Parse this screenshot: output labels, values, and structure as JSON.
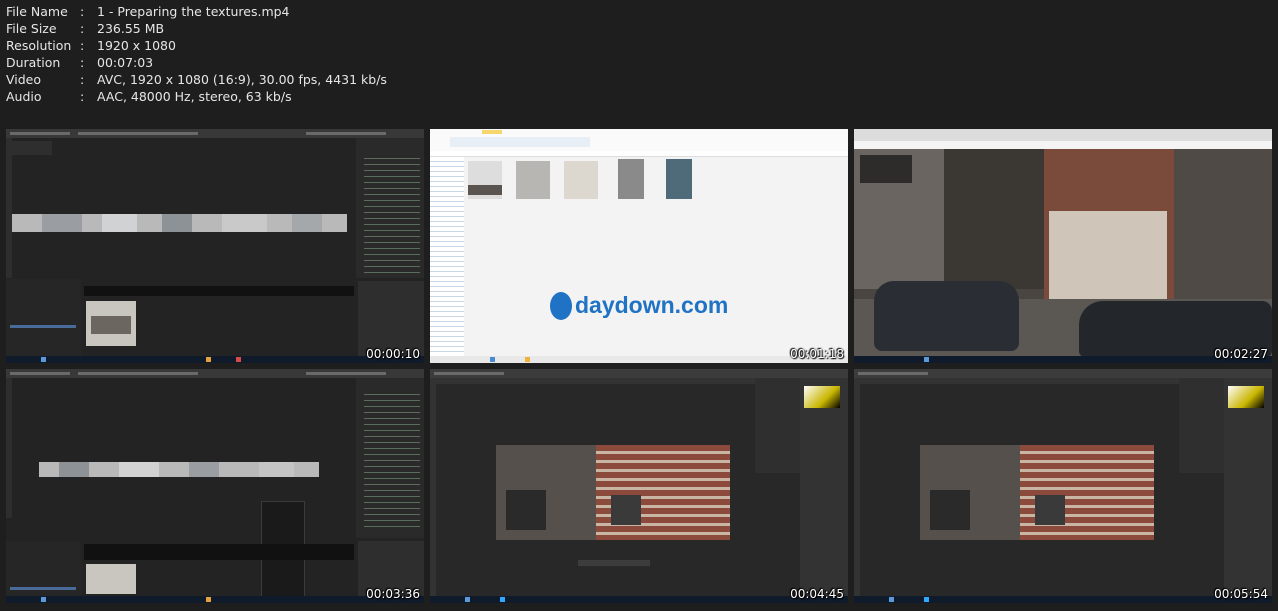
{
  "file_info": [
    {
      "label": "File Name",
      "sep": ":",
      "value": "1 - Preparing the textures.mp4"
    },
    {
      "label": "File Size",
      "sep": ":",
      "value": "236.55 MB"
    },
    {
      "label": "Resolution",
      "sep": ":",
      "value": "1920 x 1080"
    },
    {
      "label": "Duration",
      "sep": ":",
      "value": "00:07:03"
    },
    {
      "label": "Video",
      "sep": ":",
      "value": "AVC, 1920 x 1080 (16:9), 30.00 fps, 4431 kb/s"
    },
    {
      "label": "Audio",
      "sep": ":",
      "value": "AAC, 48000 Hz, stereo, 63 kb/s"
    }
  ],
  "thumbnails": [
    {
      "timestamp": "00:00:10",
      "scene": "blender-node-editor"
    },
    {
      "timestamp": "00:01:18",
      "scene": "windows-explorer",
      "watermark": "daydown.com"
    },
    {
      "timestamp": "00:02:27",
      "scene": "street-view"
    },
    {
      "timestamp": "00:03:36",
      "scene": "blender-node-editor-menu"
    },
    {
      "timestamp": "00:04:45",
      "scene": "photoshop"
    },
    {
      "timestamp": "00:05:54",
      "scene": "photoshop"
    }
  ],
  "colors": {
    "background": "#1e1e1e",
    "text": "#e6e6e6",
    "watermark_blue": "#1f72c4",
    "blender_dark": "#232323",
    "photoshop_dark": "#282828"
  }
}
